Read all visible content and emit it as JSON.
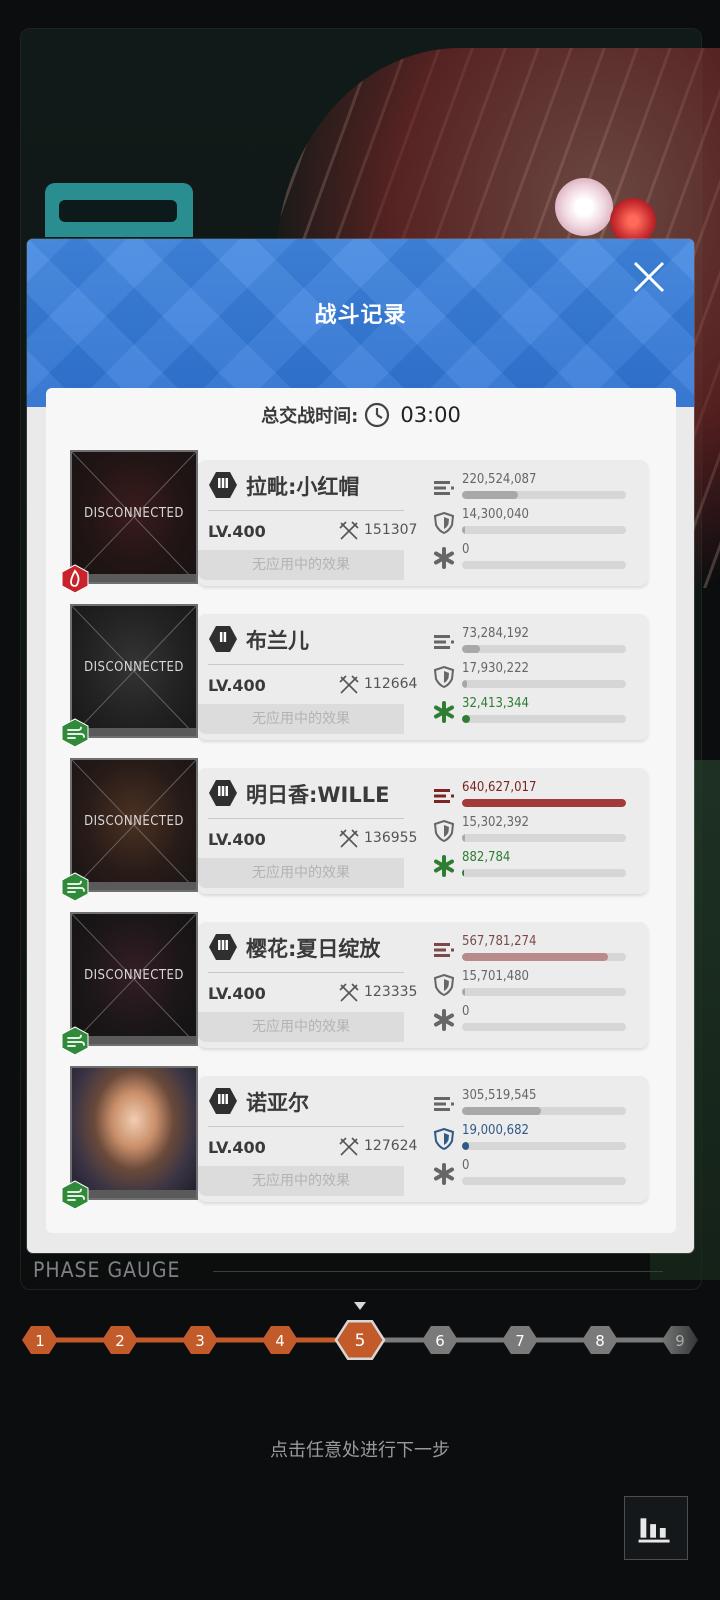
{
  "dialog": {
    "title": "战斗记录",
    "battle_time_label": "总交战时间:",
    "battle_time_value": "03:00"
  },
  "units": [
    {
      "name": "拉毗:小红帽",
      "rank": "Ⅲ",
      "level": "LV.400",
      "power": "151307",
      "status": "DISCONNECTED",
      "effect": "无应用中的效果",
      "element": "fire",
      "damage": "220,524,087",
      "damage_fraction": 0.34,
      "taken": "14,300,040",
      "taken_fraction": 0.02,
      "heal": "0",
      "heal_fraction": 0
    },
    {
      "name": "布兰儿",
      "rank": "Ⅱ",
      "level": "LV.400",
      "power": "112664",
      "status": "DISCONNECTED",
      "effect": "无应用中的效果",
      "element": "wind",
      "damage": "73,284,192",
      "damage_fraction": 0.11,
      "taken": "17,930,222",
      "taken_fraction": 0.03,
      "heal": "32,413,344",
      "heal_fraction": 0.05
    },
    {
      "name": "明日香:WILLE",
      "rank": "Ⅲ",
      "level": "LV.400",
      "power": "136955",
      "status": "DISCONNECTED",
      "effect": "无应用中的效果",
      "element": "wind",
      "damage": "640,627,017",
      "damage_fraction": 1.0,
      "taken": "15,302,392",
      "taken_fraction": 0.02,
      "heal": "882,784",
      "heal_fraction": 0.01
    },
    {
      "name": "樱花:夏日绽放",
      "rank": "Ⅲ",
      "level": "LV.400",
      "power": "123335",
      "status": "DISCONNECTED",
      "effect": "无应用中的效果",
      "element": "wind",
      "damage": "567,781,274",
      "damage_fraction": 0.89,
      "taken": "15,701,480",
      "taken_fraction": 0.02,
      "heal": "0",
      "heal_fraction": 0
    },
    {
      "name": "诺亚尔",
      "rank": "Ⅲ",
      "level": "LV.400",
      "power": "127624",
      "status": "",
      "effect": "无应用中的效果",
      "element": "wind",
      "damage": "305,519,545",
      "damage_fraction": 0.48,
      "taken": "19,000,682",
      "taken_fraction": 0.04,
      "heal": "0",
      "heal_fraction": 0
    }
  ],
  "phase_gauge": {
    "title": "PHASE GAUGE",
    "current": 5,
    "nodes": [
      "1",
      "2",
      "3",
      "4",
      "5",
      "6",
      "7",
      "8",
      "9"
    ]
  },
  "hint": "点击任意处进行下一步",
  "colors": {
    "header_blue": "#3a7fdc",
    "damage_top": "#a23a3a",
    "heal_green": "#2f7d32",
    "taken_blue": "#2f5a86",
    "phase_active": "#c25a2a"
  }
}
